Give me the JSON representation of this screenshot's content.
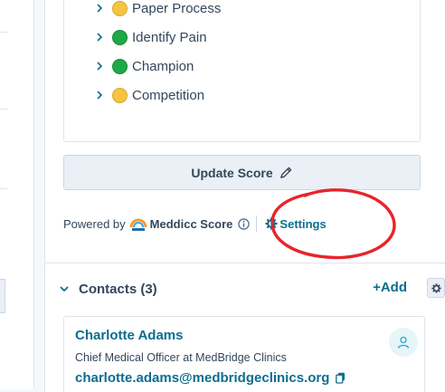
{
  "criteria": [
    {
      "label": "Paper Process",
      "status": "yellow"
    },
    {
      "label": "Identify Pain",
      "status": "green"
    },
    {
      "label": "Champion",
      "status": "green"
    },
    {
      "label": "Competition",
      "status": "yellow"
    }
  ],
  "update_button": {
    "label": "Update Score",
    "icon": "pencil-icon"
  },
  "powered": {
    "prefix": "Powered by",
    "brand": "Meddicc Score",
    "settings_label": "Settings"
  },
  "contacts": {
    "title": "Contacts (3)",
    "add_label": "+Add",
    "items": [
      {
        "name": "Charlotte Adams",
        "role": "Chief Medical Officer at MedBridge Clinics",
        "email": "charlotte.adams@medbridgeclinics.org"
      }
    ]
  },
  "colors": {
    "link": "#0b6e8f",
    "text": "#33475b",
    "status_green": "#1fa846",
    "status_yellow": "#f6c443",
    "highlight_red": "#e8242c"
  }
}
